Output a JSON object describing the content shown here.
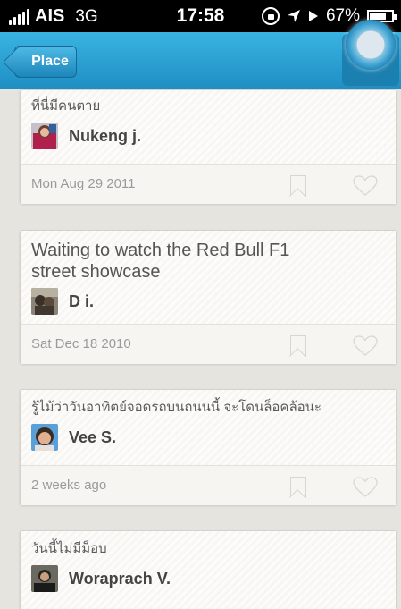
{
  "status_bar": {
    "carrier": "AIS",
    "network": "3G",
    "time": "17:58",
    "battery": "67%"
  },
  "nav": {
    "back_label": "Place"
  },
  "posts": [
    {
      "text": "ที่นี่มีคนตาย",
      "author": "Nukeng j.",
      "date": "Mon Aug 29 2011"
    },
    {
      "text": "Waiting to watch the Red Bull F1 street showcase",
      "author": "D i.",
      "date": "Sat Dec 18 2010"
    },
    {
      "text": "รู้ไม้ว่าวันอาทิตย์จอดรถบนถนนนี้ จะโดนล็อคล้อนะ",
      "author": "Vee S.",
      "date": "2 weeks ago"
    },
    {
      "text": "วันนี้ไม่มีม็อบ",
      "author": "Woraprach V.",
      "date": ""
    }
  ],
  "colors": {
    "nav_blue": "#2a9fd3",
    "background": "#e6e4df"
  }
}
